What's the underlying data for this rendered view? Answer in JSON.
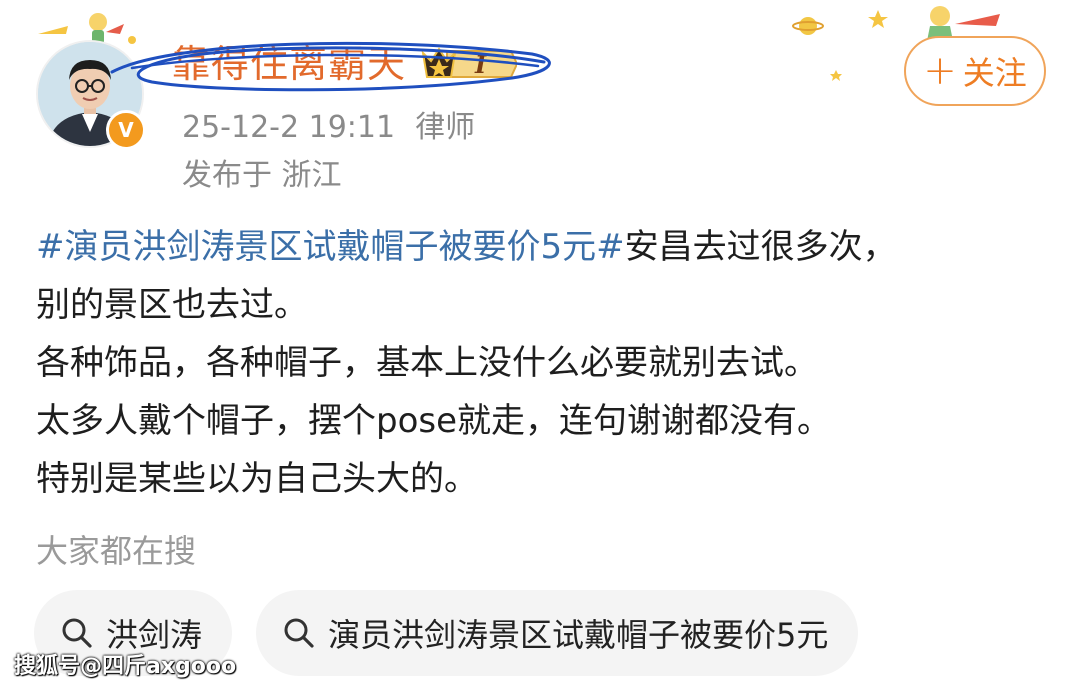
{
  "post": {
    "author": {
      "name": "靠得住离霸天",
      "vip_level": "I",
      "verified": "V"
    },
    "meta": {
      "timestamp": "25-12-2 19:11",
      "role": "律师",
      "location": "发布于 浙江"
    },
    "follow_label": "关注",
    "body": {
      "hashtag": "#演员洪剑涛景区试戴帽子被要价5元#",
      "line1_rest": "安昌去过很多次，",
      "line2": "别的景区也去过。",
      "line3": "各种饰品，各种帽子，基本上没什么必要就别去试。",
      "line4": "太多人戴个帽子，摆个pose就走，连句谢谢都没有。",
      "line5": "特别是某些以为自己头大的。"
    }
  },
  "search": {
    "heading": "大家都在搜",
    "chips": [
      {
        "label": "洪剑涛"
      },
      {
        "label": "演员洪剑涛景区试戴帽子被要价5元"
      }
    ]
  },
  "watermark": "搜狐号@四斤axgooo",
  "colors": {
    "hashtag": "#3b6fa8",
    "follow": "#ee7d24",
    "username": "#e26a2c",
    "scribble": "#1f4fbf"
  }
}
